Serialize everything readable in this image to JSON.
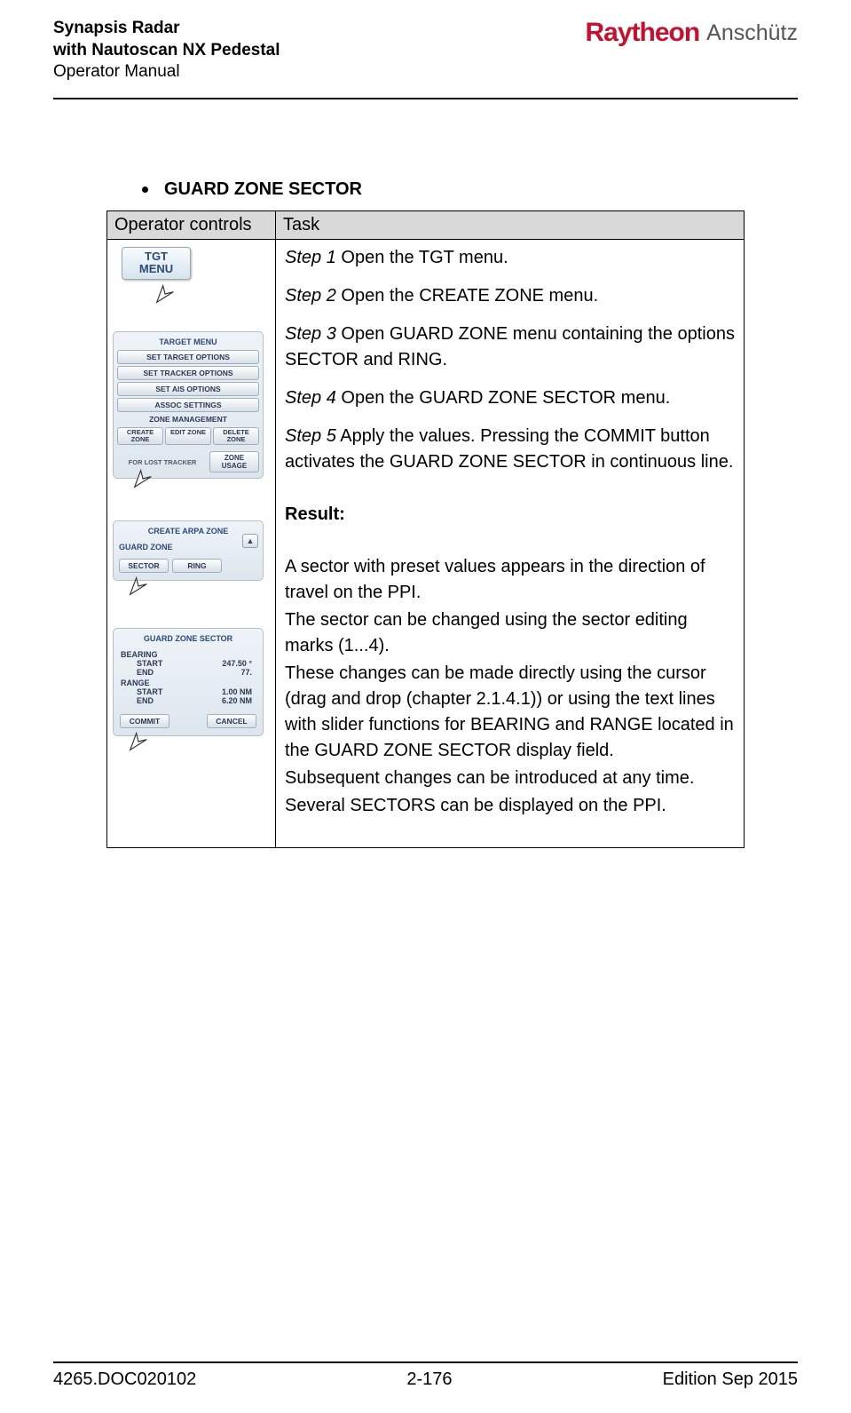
{
  "header": {
    "line1": "Synapsis Radar",
    "line2": "with Nautoscan NX Pedestal",
    "line3": "Operator Manual",
    "brand1": "Raytheon",
    "brand2": "Anschütz"
  },
  "section": {
    "title": "GUARD ZONE SECTOR"
  },
  "table": {
    "col1": "Operator controls",
    "col2": "Task"
  },
  "ui": {
    "tgt_menu_line1": "TGT",
    "tgt_menu_line2": "MENU",
    "target_menu_title": "TARGET MENU",
    "set_target": "SET TARGET OPTIONS",
    "set_tracker": "SET TRACKER OPTIONS",
    "set_ais": "SET AIS OPTIONS",
    "assoc": "ASSOC SETTINGS",
    "zone_mgmt": "ZONE MANAGEMENT",
    "create_zone": "CREATE ZONE",
    "edit_zone": "EDIT ZONE",
    "delete_zone": "DELETE ZONE",
    "for_lost": "FOR LOST TRACKER",
    "zone_usage": "ZONE USAGE",
    "create_arpa_title": "CREATE ARPA ZONE",
    "guard_zone_label": "GUARD ZONE",
    "sector_btn": "SECTOR",
    "ring_btn": "RING",
    "gz_sector_title": "GUARD ZONE SECTOR",
    "bearing_label": "BEARING",
    "range_label": "RANGE",
    "start_label": "START",
    "end_label": "END",
    "bearing_start_val": "247.50 °",
    "bearing_end_val": "77.",
    "range_start_val": "1.00 NM",
    "range_end_val": "6.20 NM",
    "commit": "COMMIT",
    "cancel": "CANCEL",
    "collapse_glyph": "▲"
  },
  "steps": {
    "s1_label": "Step 1",
    "s1_text": " Open the TGT menu.",
    "s2_label": "Step 2",
    "s2_text": " Open the CREATE ZONE menu.",
    "s3_label": "Step 3",
    "s3_text": " Open GUARD ZONE menu containing the options SECTOR and RING.",
    "s4_label": "Step 4",
    "s4_text": " Open the GUARD ZONE SECTOR menu.",
    "s5_label": "Step 5",
    "s5_text": " Apply the values. Pressing the COMMIT button activates the GUARD ZONE SECTOR in continuous line."
  },
  "result": {
    "label": "Result:",
    "p1": "A sector with preset values appears in the direction of travel on the PPI.",
    "p2": "The sector can be changed using the sector editing marks (1...4).",
    "p3": "These changes can be made directly using the cursor (drag and drop (chapter 2.1.4.1)) or using the text lines with slider functions for BEARING and RANGE located in the GUARD ZONE SECTOR display field.",
    "p4": "Subsequent changes can be introduced at any time.",
    "p5": "Several SECTORS can be displayed on the PPI."
  },
  "footer": {
    "left": "4265.DOC020102",
    "center": "2-176",
    "right": "Edition Sep 2015"
  }
}
